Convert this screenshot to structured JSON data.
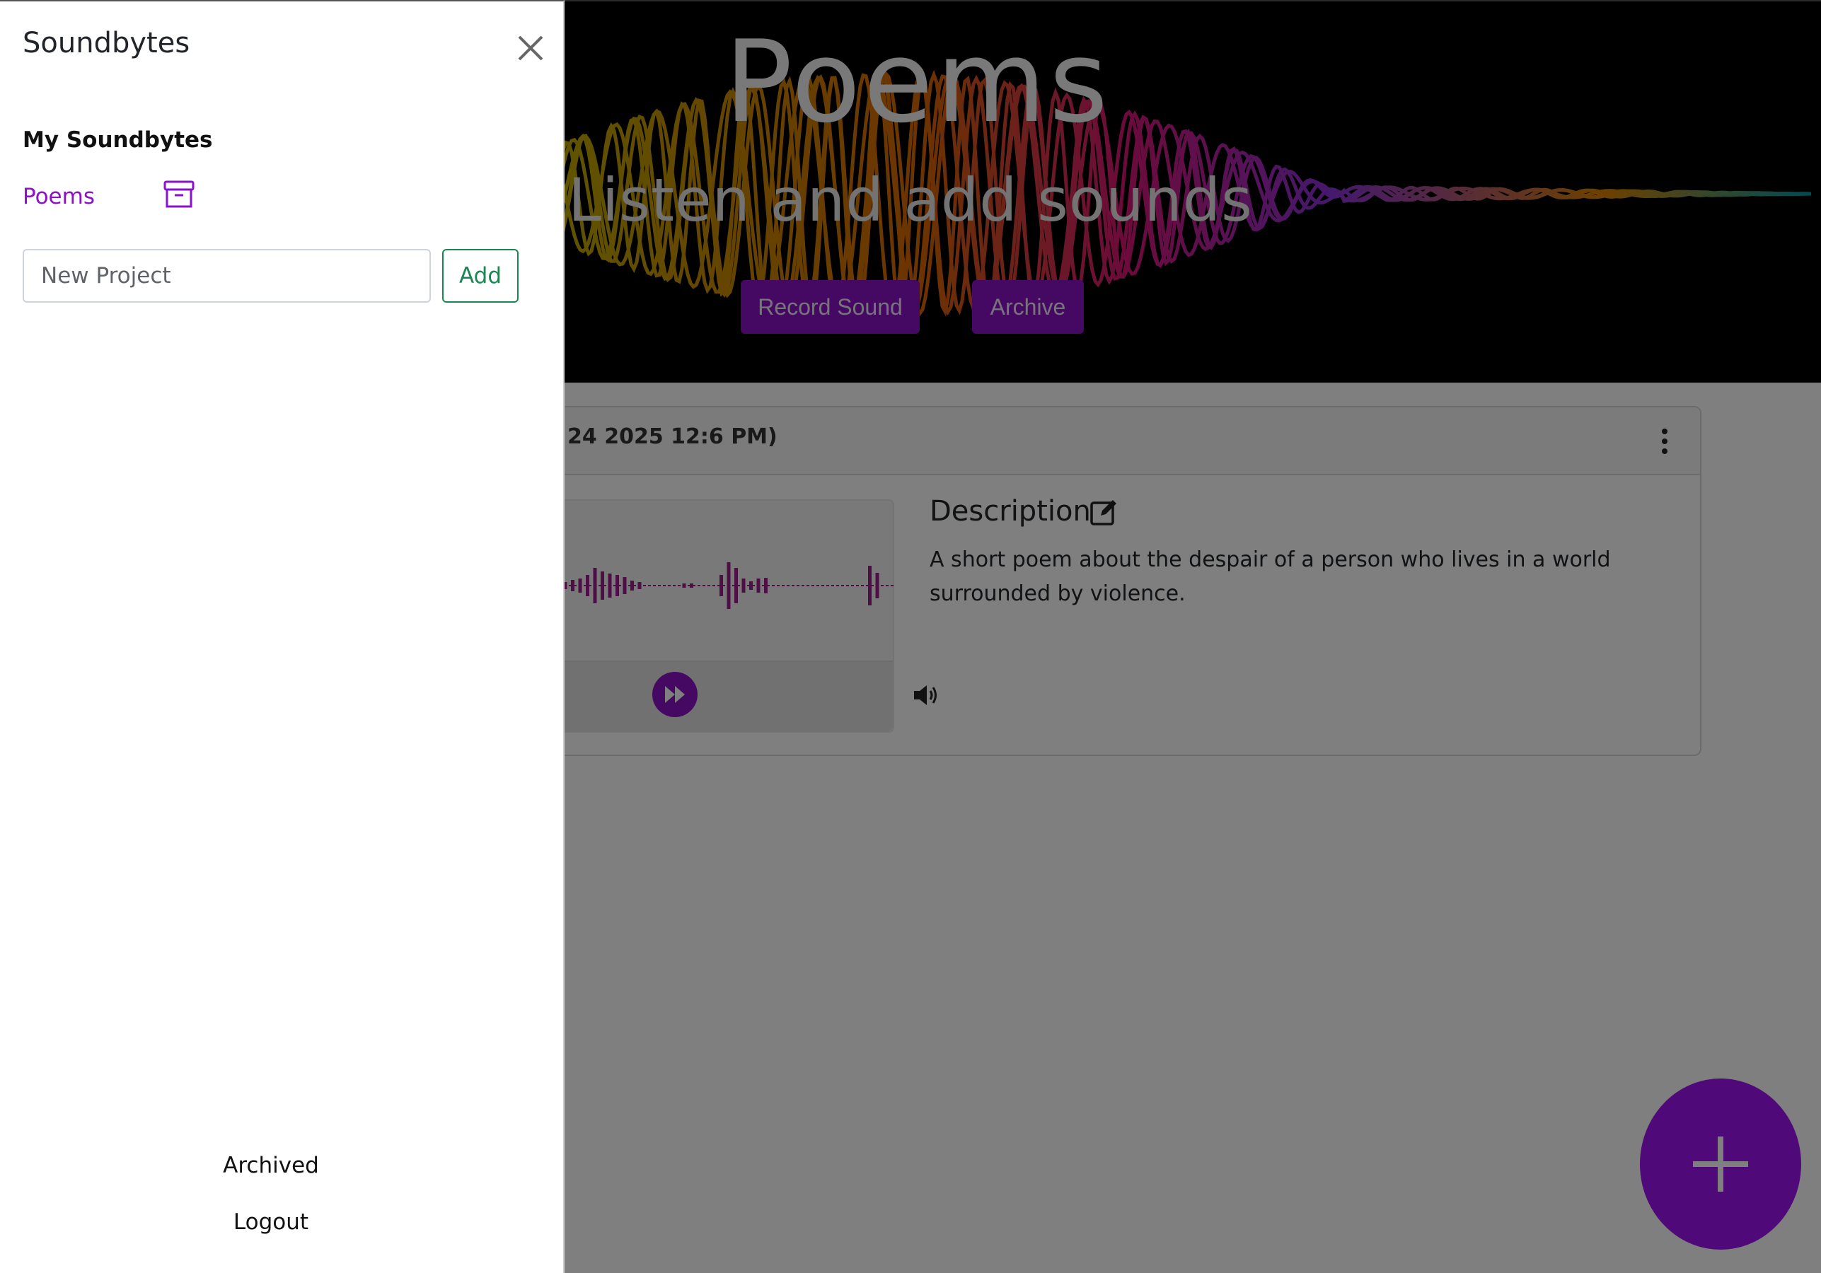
{
  "sidebar": {
    "title": "Soundbytes",
    "section_title": "My Soundbytes",
    "projects": [
      {
        "label": "Poems"
      }
    ],
    "new_project": {
      "placeholder": "New Project",
      "value": ""
    },
    "add_label": "Add",
    "archived_label": "Archived",
    "logout_label": "Logout"
  },
  "hero": {
    "title": "Poems",
    "subtitle": "Listen and add sounds",
    "record_label": "Record Sound",
    "archive_label": "Archive"
  },
  "soundbyte": {
    "date_text": "24 2025 12:6 PM)",
    "description_title": "Description",
    "description_text": "A short poem about the despair of a person who lives in a world surrounded by violence."
  },
  "colors": {
    "accent": "#8a12c8",
    "fab": "#9e12f0",
    "add_button": "#198754",
    "waveform": "#9c1d8c"
  },
  "icons": {
    "close": "close-icon",
    "archive": "archive-box-icon",
    "edit": "edit-icon",
    "more": "more-vertical-icon",
    "fast_forward": "fast-forward-icon",
    "volume": "volume-icon",
    "add": "plus-icon"
  }
}
